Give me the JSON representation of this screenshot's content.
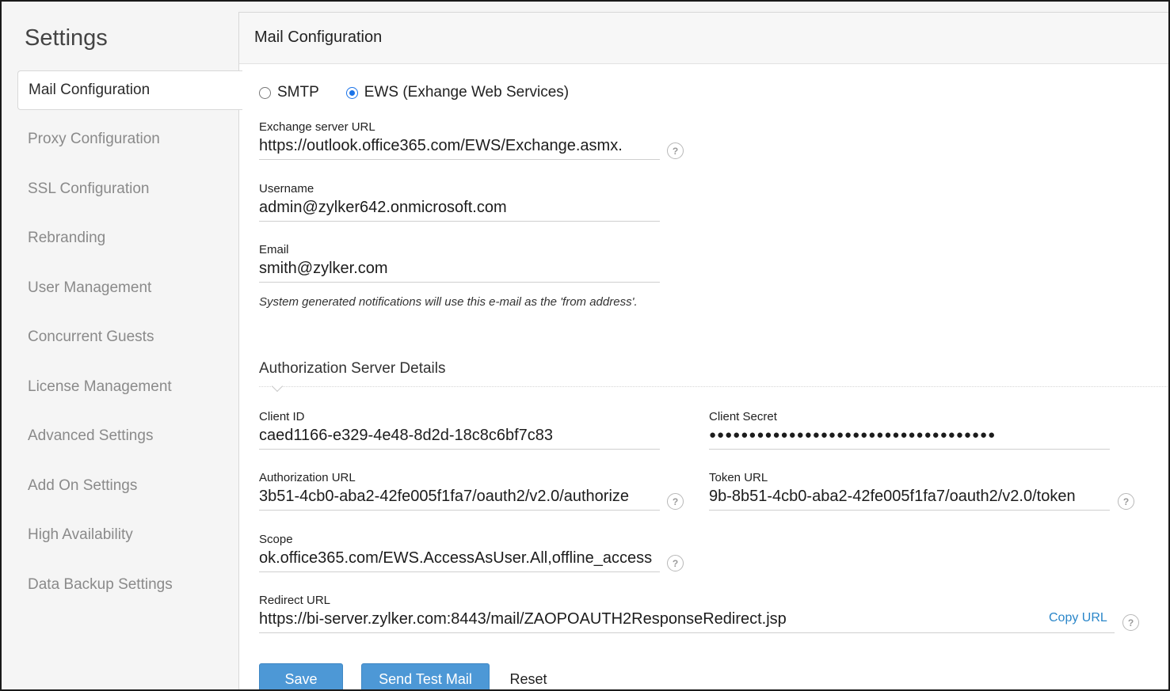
{
  "sidebar": {
    "title": "Settings",
    "items": [
      {
        "label": "Mail Configuration"
      },
      {
        "label": "Proxy Configuration"
      },
      {
        "label": "SSL Configuration"
      },
      {
        "label": "Rebranding"
      },
      {
        "label": "User Management"
      },
      {
        "label": "Concurrent Guests"
      },
      {
        "label": "License Management"
      },
      {
        "label": "Advanced Settings"
      },
      {
        "label": "Add On Settings"
      },
      {
        "label": "High Availability"
      },
      {
        "label": "Data Backup Settings"
      }
    ]
  },
  "main": {
    "title": "Mail Configuration",
    "mail_type": {
      "options": [
        {
          "label": "SMTP",
          "selected": false
        },
        {
          "label": "EWS (Exhange Web Services)",
          "selected": true
        }
      ]
    },
    "exchange_url": {
      "label": "Exchange server URL",
      "value": "https://outlook.office365.com/EWS/Exchange.asmx."
    },
    "username": {
      "label": "Username",
      "value": "admin@zylker642.onmicrosoft.com"
    },
    "email": {
      "label": "Email",
      "value": "smith@zylker.com",
      "hint": "System generated notifications will use this e-mail as the 'from address'."
    },
    "auth_section": {
      "title": "Authorization Server Details"
    },
    "client_id": {
      "label": "Client ID",
      "value": "caed1166-e329-4e48-8d2d-18c8c6bf7c83"
    },
    "client_secret": {
      "label": "Client Secret",
      "value": "●●●●●●●●●●●●●●●●●●●●●●●●●●●●●●●●●●●●"
    },
    "authorization_url": {
      "label": "Authorization URL",
      "value": "3b51-4cb0-aba2-42fe005f1fa7/oauth2/v2.0/authorize"
    },
    "token_url": {
      "label": "Token URL",
      "value": "9b-8b51-4cb0-aba2-42fe005f1fa7/oauth2/v2.0/token"
    },
    "scope": {
      "label": "Scope",
      "value": "ok.office365.com/EWS.AccessAsUser.All,offline_access"
    },
    "redirect_url": {
      "label": "Redirect URL",
      "value": "https://bi-server.zylker.com:8443/mail/ZAOPOAUTH2ResponseRedirect.jsp",
      "copy_label": "Copy URL"
    },
    "help_glyph": "?",
    "buttons": {
      "save": "Save",
      "send_test": "Send Test Mail",
      "reset": "Reset"
    }
  },
  "colors": {
    "accent": "#4d98d6",
    "link": "#2a86c9",
    "radio_selected": "#1a73e8"
  }
}
